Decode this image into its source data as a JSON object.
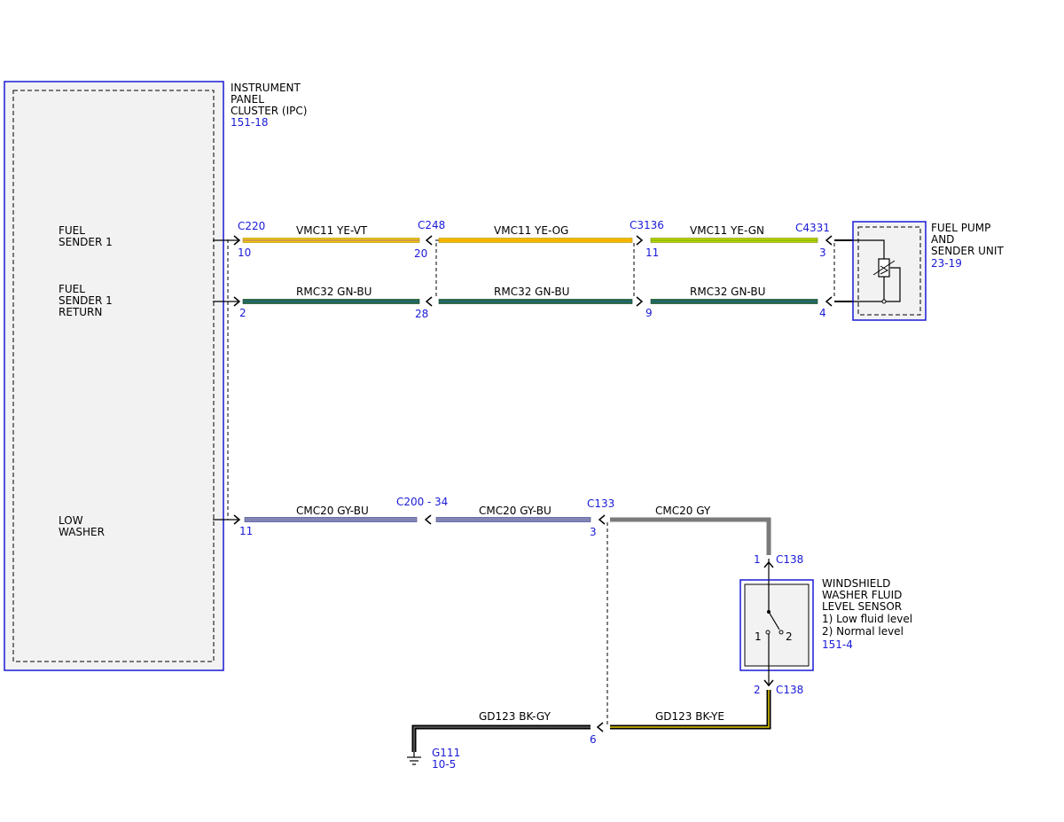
{
  "colors": {
    "blue": "#1a1ad8",
    "ye_vt": "#f0c800",
    "ye_og": "#f2c200",
    "ye_gn": "#c8d800",
    "gn_bu": "#1c6b3c",
    "gy_bu": "#7f85c0",
    "gy": "#808080",
    "bk": "#000000",
    "ye": "#e8d000"
  },
  "ipc": {
    "name_lines": [
      "INSTRUMENT",
      "PANEL",
      "CLUSTER (IPC)"
    ],
    "ref": "151-18",
    "pins": [
      {
        "lines": [
          "FUEL",
          "SENDER 1"
        ]
      },
      {
        "lines": [
          "FUEL",
          "SENDER 1",
          "RETURN"
        ]
      },
      {
        "lines": [
          "LOW",
          "WASHER"
        ]
      }
    ]
  },
  "fuel_pump": {
    "name_lines": [
      "FUEL PUMP",
      "AND",
      "SENDER UNIT"
    ],
    "ref": "23-19"
  },
  "washer_sensor": {
    "name_lines": [
      "WINDSHIELD",
      "WASHER FLUID",
      "LEVEL SENSOR",
      "1) Low fluid level",
      "2) Normal level"
    ],
    "ref": "151-4",
    "switch_pins": [
      "1",
      "2"
    ]
  },
  "ground": {
    "name": "G111",
    "ref": "10-5"
  },
  "connectors": {
    "c220": "C220",
    "c248": "C248",
    "c3136": "C3136",
    "c4331": "C4331",
    "c200": "C200",
    "c200_sep": "-",
    "c200_pin": "34",
    "c133": "C133",
    "c138_top": "C138",
    "c138_bottom": "C138"
  },
  "circuits": {
    "fuel_sender": {
      "seg1": "VMC11  YE-VT",
      "seg2": "VMC11  YE-OG",
      "seg3": "VMC11  YE-GN",
      "pins": [
        "10",
        "20",
        "11",
        "3"
      ]
    },
    "fuel_return": {
      "seg1": "RMC32  GN-BU",
      "seg2": "RMC32  GN-BU",
      "seg3": "RMC32  GN-BU",
      "pins": [
        "2",
        "28",
        "9",
        "4"
      ]
    },
    "low_washer": {
      "seg1": "CMC20  GY-BU",
      "seg2": "CMC20  GY-BU",
      "seg3": "CMC20  GY",
      "pins": [
        "11",
        "3",
        "1",
        "2"
      ]
    },
    "ground": {
      "seg1": "GD123  BK-GY",
      "seg2": "GD123  BK-YE",
      "pins": [
        "6"
      ]
    }
  }
}
